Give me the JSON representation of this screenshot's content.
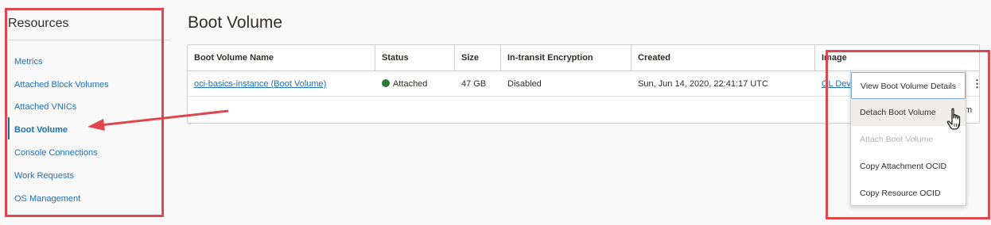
{
  "sidebar": {
    "title": "Resources",
    "items": [
      {
        "label": "Metrics"
      },
      {
        "label": "Attached Block Volumes"
      },
      {
        "label": "Attached VNICs"
      },
      {
        "label": "Boot Volume"
      },
      {
        "label": "Console Connections"
      },
      {
        "label": "Work Requests"
      },
      {
        "label": "OS Management"
      }
    ],
    "active_item": "Boot Volume"
  },
  "main": {
    "title": "Boot Volume"
  },
  "table": {
    "columns": [
      "Boot Volume Name",
      "Status",
      "Size",
      "In-transit Encryption",
      "Created",
      "Image"
    ],
    "rows": [
      {
        "name": "oci-basics-instance (Boot Volume)",
        "status": "Attached",
        "size": "47 GB",
        "encryption": "Disabled",
        "created": "Sun, Jun 14, 2020, 22:41:17 UTC",
        "image": "OL Dev"
      }
    ],
    "footer_tail": "m"
  },
  "row_menu": {
    "items": [
      {
        "label": "View Boot Volume Details",
        "state": "focused"
      },
      {
        "label": "Detach Boot Volume",
        "state": "hover"
      },
      {
        "label": "Attach Boot Volume",
        "state": "disabled"
      },
      {
        "label": "Copy Attachment OCID",
        "state": "normal"
      },
      {
        "label": "Copy Resource OCID",
        "state": "normal"
      }
    ]
  },
  "colors": {
    "link": "#1b6fb8",
    "status_attached": "#2b7a3b",
    "annotation_red": "#e0464d"
  },
  "icons": {
    "row_actions": "kebab-icon",
    "cursor": "hand-pointer-icon",
    "status": "status-dot-icon"
  }
}
